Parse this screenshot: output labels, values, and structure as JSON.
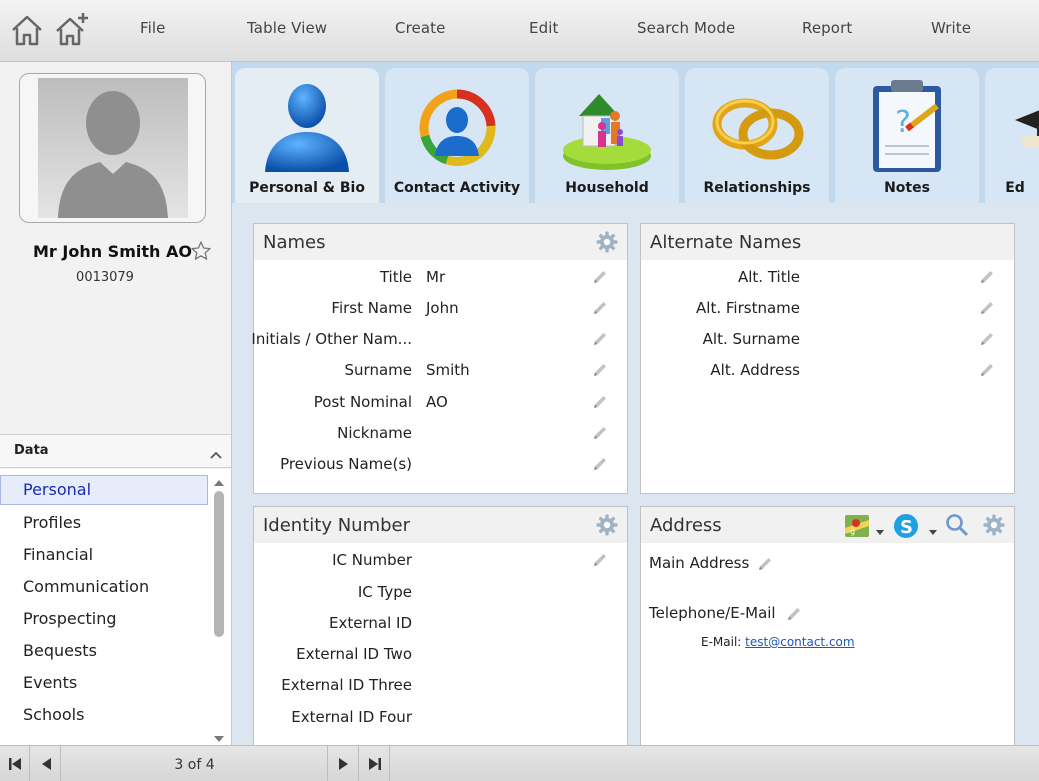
{
  "menu": {
    "items": [
      "File",
      "Table View",
      "Create",
      "Edit",
      "Search Mode",
      "Report",
      "Write"
    ]
  },
  "profile": {
    "name": "Mr John Smith AO",
    "id": "0013079"
  },
  "data_nav": {
    "header": "Data",
    "items": [
      "Personal",
      "Profiles",
      "Financial",
      "Communication",
      "Prospecting",
      "Bequests",
      "Events",
      "Schools"
    ],
    "selected": "Personal"
  },
  "pager": {
    "count": "3 of 4"
  },
  "tabs": [
    {
      "label": "Personal & Bio",
      "icon": "person-icon"
    },
    {
      "label": "Contact Activity",
      "icon": "contact-activity-icon"
    },
    {
      "label": "Household",
      "icon": "household-icon"
    },
    {
      "label": "Relationships",
      "icon": "rings-icon"
    },
    {
      "label": "Notes",
      "icon": "clipboard-icon"
    },
    {
      "label": "Ed",
      "icon": "graduation-cap-icon"
    }
  ],
  "names_panel": {
    "title": "Names",
    "fields": [
      {
        "label": "Title",
        "value": "Mr"
      },
      {
        "label": "First Name",
        "value": "John"
      },
      {
        "label": "Initials / Other Nam...",
        "value": ""
      },
      {
        "label": "Surname",
        "value": "Smith"
      },
      {
        "label": "Post Nominal",
        "value": "AO"
      },
      {
        "label": "Nickname",
        "value": ""
      },
      {
        "label": "Previous Name(s)",
        "value": ""
      }
    ]
  },
  "alt_names_panel": {
    "title": "Alternate Names",
    "fields": [
      {
        "label": "Alt. Title",
        "value": ""
      },
      {
        "label": "Alt. Firstname",
        "value": ""
      },
      {
        "label": "Alt. Surname",
        "value": ""
      },
      {
        "label": "Alt. Address",
        "value": ""
      }
    ]
  },
  "identity_panel": {
    "title": "Identity Number",
    "fields": [
      {
        "label": "IC Number",
        "value": ""
      },
      {
        "label": "IC Type",
        "value": ""
      },
      {
        "label": "External ID",
        "value": ""
      },
      {
        "label": "External ID Two",
        "value": ""
      },
      {
        "label": "External ID Three",
        "value": ""
      },
      {
        "label": "External ID Four",
        "value": ""
      }
    ]
  },
  "address_panel": {
    "title": "Address",
    "main_address_label": "Main Address",
    "telephone_label": "Telephone/E-Mail",
    "email_label": "E-Mail:",
    "email_value": "test@contact.com"
  },
  "colors": {
    "accent_blue": "#1f57b5",
    "selection_bg": "#e7ecfb",
    "tab_strip": "#c2d8ec"
  }
}
